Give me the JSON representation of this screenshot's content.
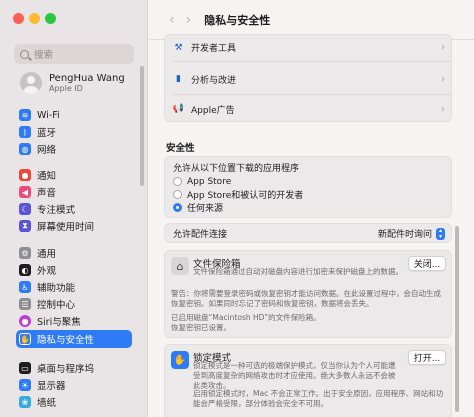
{
  "window": {
    "title": "隐私与安全性"
  },
  "sidebar": {
    "search_placeholder": "搜索",
    "account": {
      "name": "PengHua Wang",
      "subtitle": "Apple ID"
    },
    "items": [
      {
        "label": "Wi-Fi",
        "icon": "wifi-icon",
        "color": "#2f7bf6"
      },
      {
        "label": "蓝牙",
        "icon": "bluetooth-icon",
        "color": "#2f7bf6"
      },
      {
        "label": "网络",
        "icon": "globe-icon",
        "color": "#2f7bf6"
      },
      {
        "label": "通知",
        "icon": "bell-icon",
        "color": "#f0453a"
      },
      {
        "label": "声音",
        "icon": "speaker-icon",
        "color": "#ee4a7c"
      },
      {
        "label": "专注模式",
        "icon": "moon-icon",
        "color": "#5a55d6"
      },
      {
        "label": "屏幕使用时间",
        "icon": "hourglass-icon",
        "color": "#5a55d6"
      },
      {
        "label": "通用",
        "icon": "gear-icon",
        "color": "#8e8e93"
      },
      {
        "label": "外观",
        "icon": "appearance-icon",
        "color": "#1d1d1f"
      },
      {
        "label": "辅助功能",
        "icon": "accessibility-icon",
        "color": "#2f7bf6"
      },
      {
        "label": "控制中心",
        "icon": "control-center-icon",
        "color": "#8e8e93"
      },
      {
        "label": "Siri与聚焦",
        "icon": "siri-icon",
        "color": "#c13bd6"
      },
      {
        "label": "隐私与安全性",
        "icon": "hand-icon",
        "color": "#2f7bf6",
        "active": true
      },
      {
        "label": "桌面与程序坞",
        "icon": "dock-icon",
        "color": "#1d1d1f"
      },
      {
        "label": "显示器",
        "icon": "display-icon",
        "color": "#2f7bf6"
      },
      {
        "label": "墙纸",
        "icon": "wallpaper-icon",
        "color": "#35aadc"
      }
    ]
  },
  "main": {
    "top_rows": [
      {
        "label": "开发者工具",
        "icon": "hammer-icon"
      },
      {
        "label": "分析与改进",
        "icon": "chart-icon"
      },
      {
        "label": "Apple广告",
        "icon": "megaphone-icon"
      }
    ],
    "security": {
      "heading": "安全性",
      "allow_label": "允许从以下位置下载的应用程序",
      "options": [
        {
          "label": "App Store",
          "selected": false
        },
        {
          "label": "App Store和被认可的开发者",
          "selected": false
        },
        {
          "label": "任何来源",
          "selected": true
        }
      ]
    },
    "accessory": {
      "label": "允许配件连接",
      "value": "新配件时询问"
    },
    "filevault": {
      "title": "文件保险箱",
      "description": "文件保险箱通过自动对磁盘内容进行加密来保护磁盘上的数据。",
      "button": "关闭...",
      "warning": "警告：你将需要登录密码或恢复密钥才能访问数据。在此设置过程中，会自动生成恢复密钥。如果同时忘记了密码和恢复密钥，数据将会丢失。",
      "status_line1": "已启用磁盘“Macintosh HD”的文件保险箱。",
      "status_line2": "恢复密钥已设置。"
    },
    "lockdown": {
      "title": "锁定模式",
      "description": "锁定模式是一种可选的极端保护模式，仅当你认为个人可能遭受到高度复杂的网络攻击时才应使用。绝大多数人永远不会被此类攻击。",
      "button": "打开...",
      "description2": "启用锁定模式时，Mac 不会正常工作。出于安全原因，应用程序、网站和功能会严格受限，部分体验会完全不可用。"
    }
  }
}
